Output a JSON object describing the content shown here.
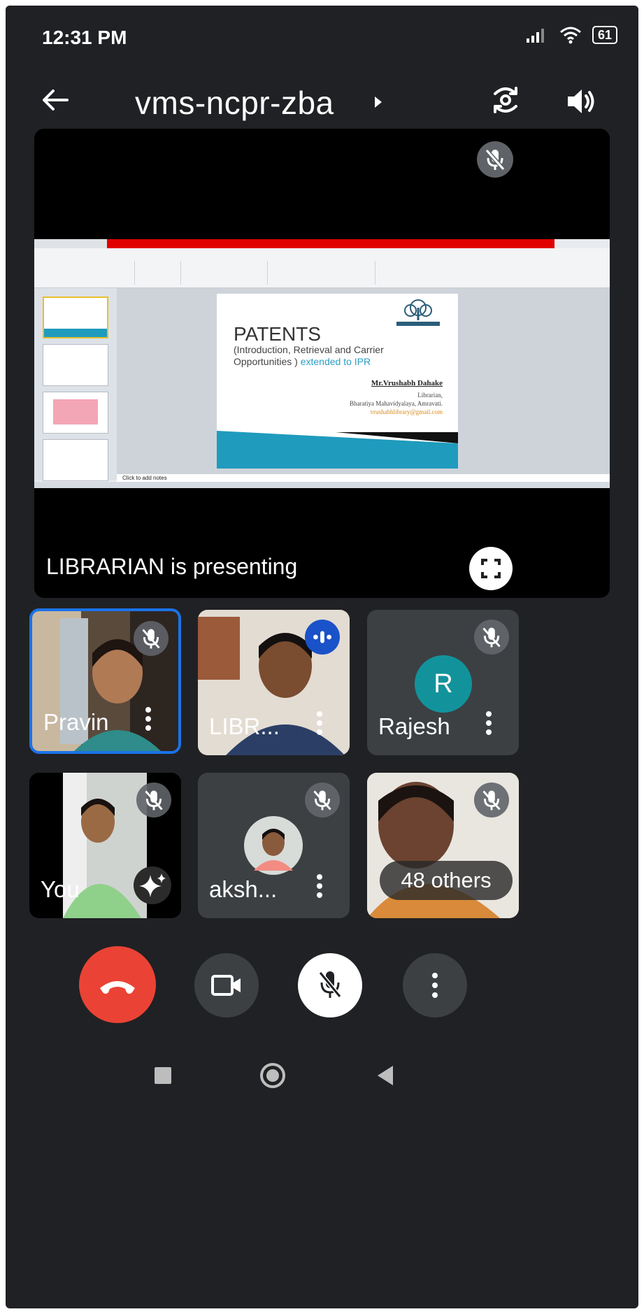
{
  "status_bar": {
    "time": "12:31 PM",
    "battery": "61"
  },
  "header": {
    "meeting_code": "vms-ncpr-zba"
  },
  "presentation": {
    "presenter_label": "LIBRARIAN is presenting",
    "slide": {
      "title": "PATENTS",
      "subtitle": "(Introduction, Retrieval and Carrier Opportunities )",
      "subtitle_highlight": "extended to IPR",
      "author": "Mr.Vrushabh Dahake",
      "role": "Librarian,",
      "institution": "Bharatiya Mahavidyalaya, Amravati.",
      "email": "vrushabhlibrary@gmail.com"
    },
    "notes_placeholder": "Click to add notes"
  },
  "participants": [
    {
      "name": "Pravin"
    },
    {
      "name": "LIBR..."
    },
    {
      "name": "Rajesh",
      "initial": "R"
    },
    {
      "name": "You"
    },
    {
      "name": "aksh..."
    },
    {
      "name": "48 others"
    }
  ],
  "colors": {
    "background": "#202124",
    "tile": "#3c4043",
    "end_call": "#ea4335",
    "avatar": "#12939b",
    "active_border": "#1a73e8"
  }
}
